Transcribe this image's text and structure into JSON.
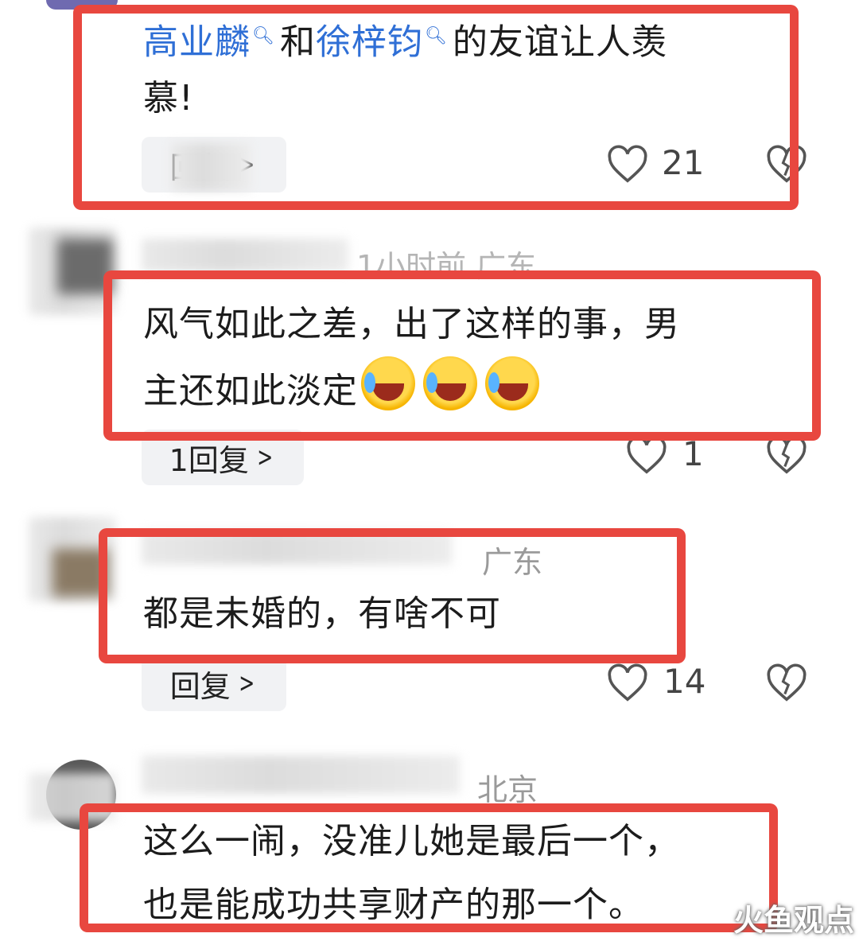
{
  "comments": [
    {
      "user": "",
      "meta": "",
      "text_parts": [
        {
          "t": "高业麟",
          "link": true
        },
        {
          "t": "和",
          "link": false
        },
        {
          "t": "徐梓钧",
          "link": true
        },
        {
          "t": "的友谊让人羡",
          "link": false
        }
      ],
      "text_line2": "慕!",
      "reply_label": "回复",
      "likes": "21"
    },
    {
      "meta_tail": "1小时前 广东",
      "text_line1": "风气如此之差，出了这样的事，男",
      "text_line2": "主还如此淡定",
      "emoji_name": "laugh-cry-emoji",
      "reply_label": "1回复",
      "likes": "1"
    },
    {
      "meta_tail": "广东",
      "text_line1": "都是未婚的，有啥不可",
      "reply_label": "回复",
      "likes": "14"
    },
    {
      "meta_tail": "北京",
      "text_line1": "这么一闹，没准儿她是最后一个，",
      "text_line2": "也是能成功共享财产的那一个。"
    }
  ],
  "watermark": "火鱼观点",
  "colors": {
    "highlight": "#e8473f",
    "link": "#2f6fd6"
  },
  "icons": {
    "like": "heart-icon",
    "dislike": "broken-heart-icon",
    "search": "search-icon",
    "chevron": "chevron-right-icon"
  }
}
